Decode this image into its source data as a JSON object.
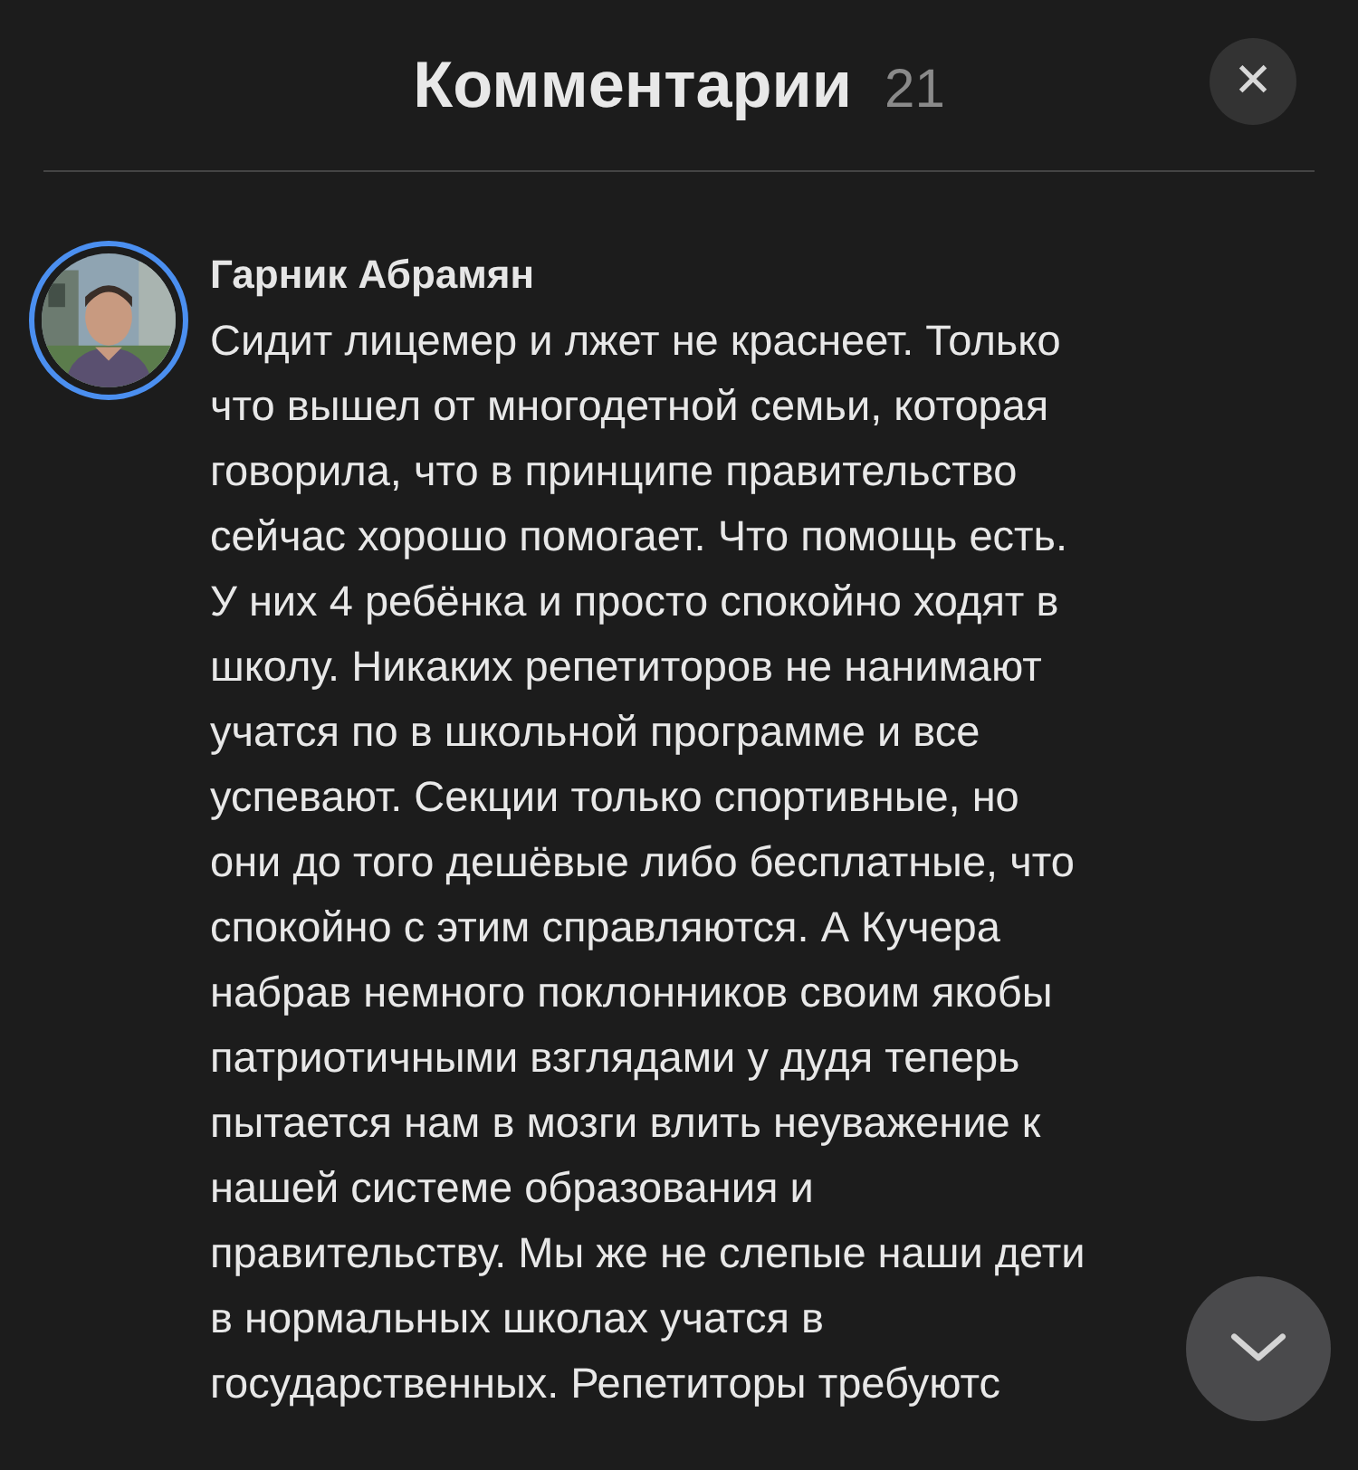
{
  "header": {
    "title": "Комментарии",
    "count": "21",
    "close_icon": "✕"
  },
  "comments": [
    {
      "kind": "picture",
      "author": "Гарник Абрамян",
      "text": "Сидит лицемер и лжет не краснеет. Только\nчто вышел от многодетной семьи, которая\nговорила, что в принципе правительство\nсейчас хорошо помогает. Что помощь есть.\nУ них 4 ребёнка и просто спокойно ходят в\nшколу. Никаких репетиторов не нанимают\nучатся по в школьной программе и все\nуспевают. Секции только спортивные, но\nони до того дешёвые либо бесплатные, что\nспокойно с этим справляются. А Кучера\nнабрав немного поклонников своим якобы\nпатриотичными взглядами у дудя теперь\nпытается нам в мозги влить неуважение к\nнашей системе образования и\nправительству. Мы же не слепые наши дети\nв нормальных школах учатся в\nгосударственных. Репетиторы требуютс"
    }
  ]
}
